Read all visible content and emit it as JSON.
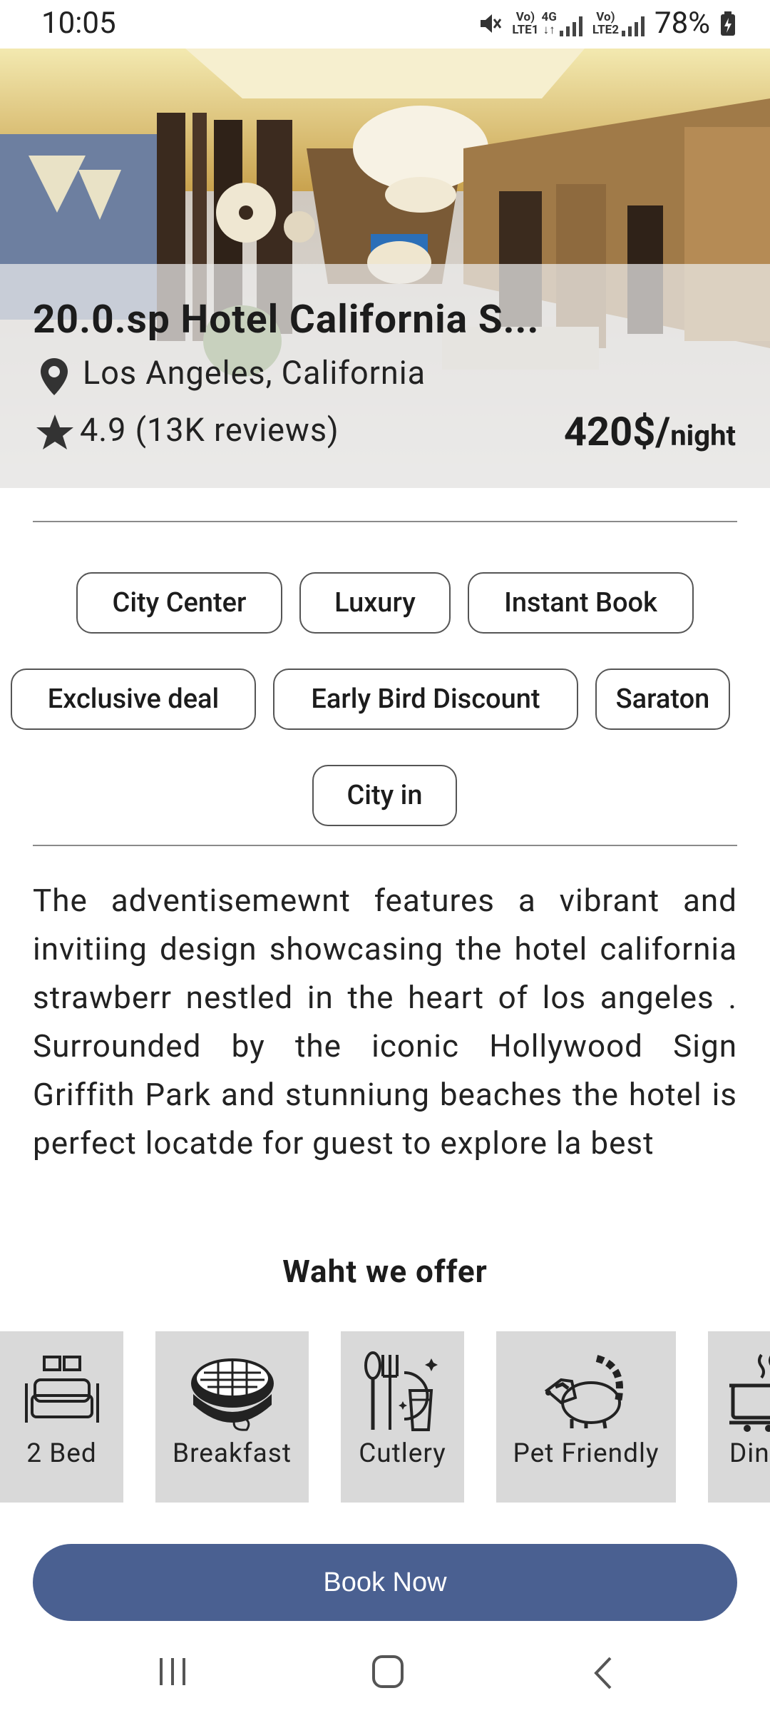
{
  "status_bar": {
    "time": "10:05",
    "sim1_top": "Vo)",
    "sim1_bottom": "LTE1",
    "network": "4G",
    "sim2_top": "Vo)",
    "sim2_bottom": "LTE2",
    "battery": "78%"
  },
  "hotel": {
    "name": "20.0.sp Hotel California S...",
    "location": "Los Angeles, California",
    "rating": "4.9 (13K reviews)",
    "price": "420$/",
    "price_unit": "night"
  },
  "tags": [
    "City Center",
    "Luxury",
    "Instant Book",
    "Exclusive deal",
    "Early Bird Discount",
    "Saraton",
    "City in"
  ],
  "description": "The adventisemewnt features a vibrant and invitiing design showcasing the hotel california strawberr nestled in the heart of los angeles . Surrounded by the iconic Hollywood Sign Griffith Park and stunniung beaches the hotel is perfect locatde for guest to explore la best",
  "offers": {
    "title": "Waht we offer",
    "items": [
      {
        "label": "2 Bed",
        "icon": "bed-icon"
      },
      {
        "label": "Breakfast",
        "icon": "waffle-icon"
      },
      {
        "label": "Cutlery",
        "icon": "cutlery-icon"
      },
      {
        "label": "Pet Friendly",
        "icon": "raccoon-icon"
      },
      {
        "label": "Dining",
        "icon": "pot-icon"
      }
    ]
  },
  "book_button": "Book Now",
  "colors": {
    "primary": "#4a6091",
    "card_bg": "#d9d9d9",
    "chip_border": "#555555"
  }
}
